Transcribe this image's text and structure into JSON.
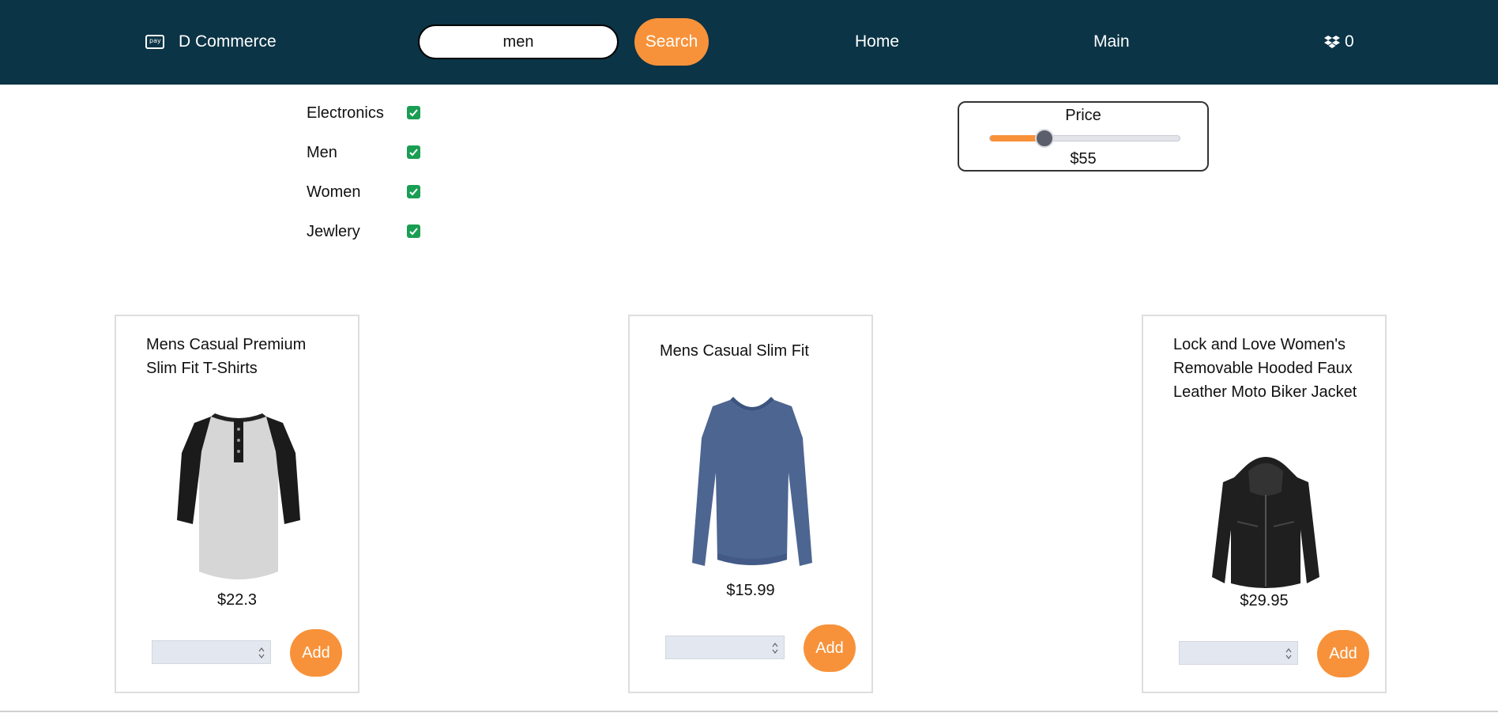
{
  "header": {
    "brand": "D Commerce",
    "brand_icon": "pay-card-icon",
    "brand_icon_text": "pay",
    "search_value": "men",
    "search_button": "Search",
    "nav_home": "Home",
    "nav_main": "Main",
    "cart_icon": "dropbox-icon",
    "cart_count": "0",
    "bg_color": "#0b3446",
    "accent_color": "#f7923a"
  },
  "filters": {
    "categories": [
      {
        "label": "Electronics",
        "checked": true
      },
      {
        "label": "Men",
        "checked": true
      },
      {
        "label": "Women",
        "checked": true
      },
      {
        "label": "Jewlery",
        "checked": true
      }
    ],
    "check_color": "#1a9e54"
  },
  "price": {
    "title": "Price",
    "value_label": "$55",
    "level": 0.29
  },
  "products": [
    {
      "title": "Mens Casual Premium Slim Fit T-Shirts",
      "price": "$22.3",
      "add_label": "Add",
      "quantity": ""
    },
    {
      "title": "Mens Casual Slim Fit",
      "price": "$15.99",
      "add_label": "Add",
      "quantity": ""
    },
    {
      "title": "Lock and Love Women's Removable Hooded Faux Leather Moto Biker Jacket",
      "price": "$29.95",
      "add_label": "Add",
      "quantity": ""
    }
  ]
}
